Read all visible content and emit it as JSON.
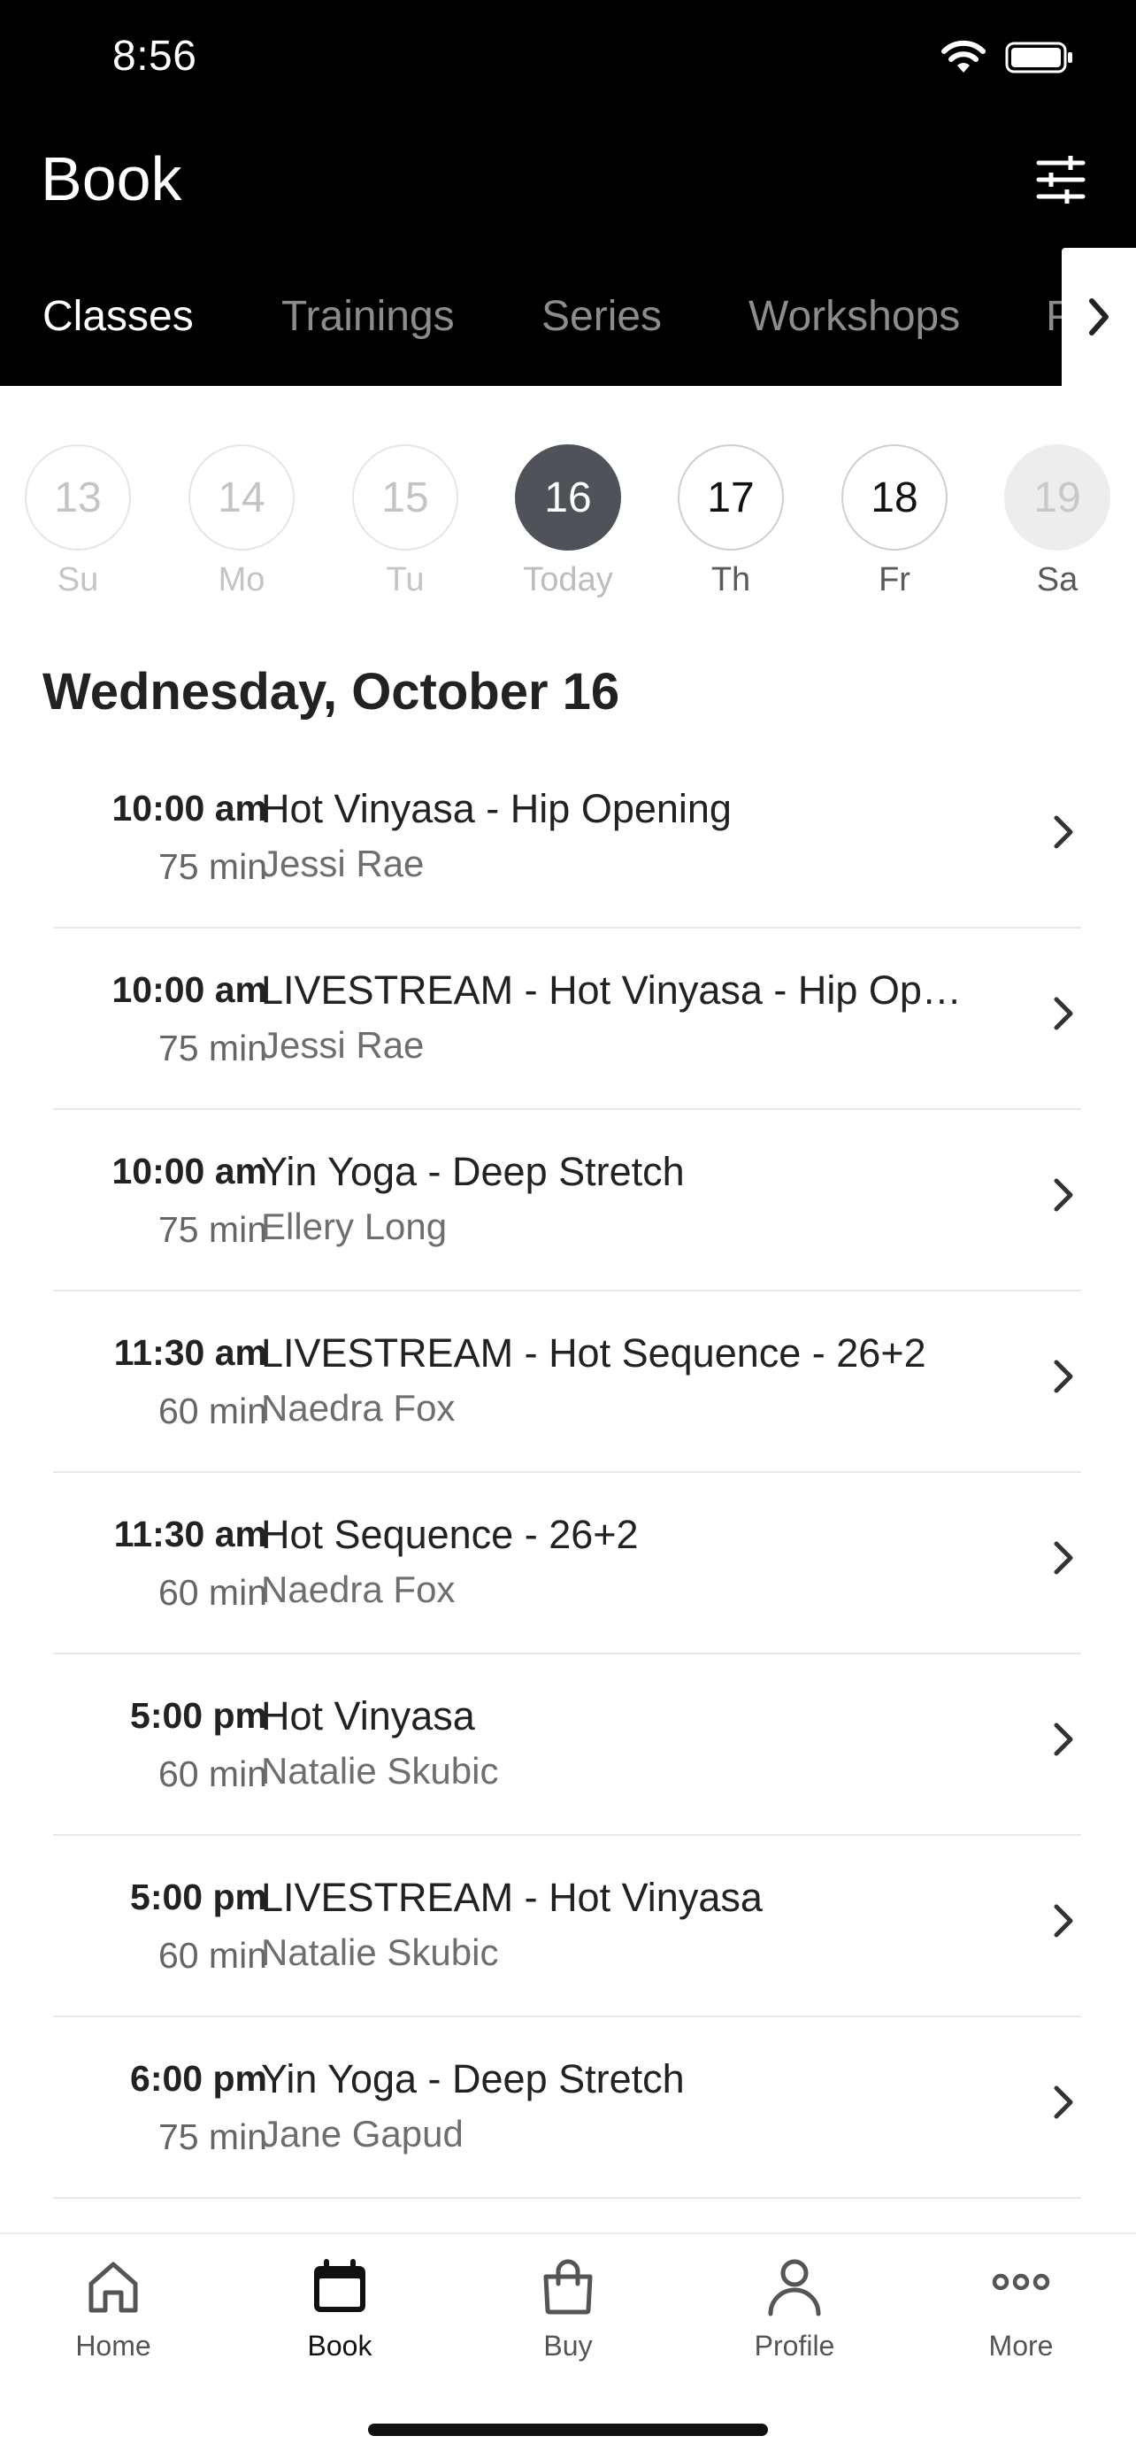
{
  "status_bar": {
    "time": "8:56"
  },
  "header": {
    "title": "Book"
  },
  "tabs": [
    {
      "label": "Classes",
      "active": true
    },
    {
      "label": "Trainings",
      "active": false
    },
    {
      "label": "Series",
      "active": false
    },
    {
      "label": "Workshops",
      "active": false
    },
    {
      "label": "P",
      "active": false
    }
  ],
  "days": [
    {
      "num": "13",
      "dow": "Su",
      "state": "past"
    },
    {
      "num": "14",
      "dow": "Mo",
      "state": "past"
    },
    {
      "num": "15",
      "dow": "Tu",
      "state": "past"
    },
    {
      "num": "16",
      "dow": "Today",
      "state": "selected"
    },
    {
      "num": "17",
      "dow": "Th",
      "state": "available"
    },
    {
      "num": "18",
      "dow": "Fr",
      "state": "available"
    },
    {
      "num": "19",
      "dow": "Sa",
      "state": "disabled"
    }
  ],
  "date_heading": "Wednesday, October 16",
  "classes": [
    {
      "time": "10:00 am",
      "duration": "75 min",
      "name": "Hot Vinyasa - Hip Opening",
      "teacher": "Jessi Rae"
    },
    {
      "time": "10:00 am",
      "duration": "75 min",
      "name": "LIVESTREAM - Hot Vinyasa - Hip Op…",
      "teacher": "Jessi Rae"
    },
    {
      "time": "10:00 am",
      "duration": "75 min",
      "name": "Yin Yoga - Deep Stretch",
      "teacher": "Ellery Long"
    },
    {
      "time": "11:30 am",
      "duration": "60 min",
      "name": "LIVESTREAM - Hot Sequence - 26+2",
      "teacher": "Naedra Fox"
    },
    {
      "time": "11:30 am",
      "duration": "60 min",
      "name": "Hot Sequence - 26+2",
      "teacher": "Naedra Fox"
    },
    {
      "time": "5:00 pm",
      "duration": "60 min",
      "name": "Hot Vinyasa",
      "teacher": "Natalie Skubic"
    },
    {
      "time": "5:00 pm",
      "duration": "60 min",
      "name": "LIVESTREAM - Hot Vinyasa",
      "teacher": "Natalie Skubic"
    },
    {
      "time": "6:00 pm",
      "duration": "75 min",
      "name": "Yin Yoga - Deep Stretch",
      "teacher": "Jane Gapud"
    }
  ],
  "bottom_nav": [
    {
      "label": "Home",
      "icon": "home-icon",
      "active": false
    },
    {
      "label": "Book",
      "icon": "calendar-icon",
      "active": true
    },
    {
      "label": "Buy",
      "icon": "shopping-bag-icon",
      "active": false
    },
    {
      "label": "Profile",
      "icon": "person-icon",
      "active": false
    },
    {
      "label": "More",
      "icon": "more-dots-icon",
      "active": false
    }
  ]
}
